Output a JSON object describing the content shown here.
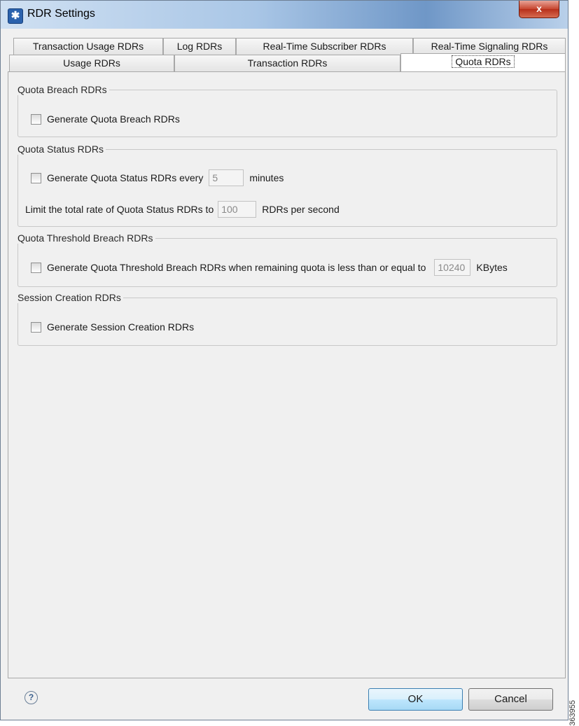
{
  "window": {
    "title": "RDR Settings",
    "close_label": "x"
  },
  "tabs_row1": [
    {
      "label": "Transaction Usage RDRs"
    },
    {
      "label": "Log RDRs"
    },
    {
      "label": "Real-Time Subscriber RDRs"
    },
    {
      "label": "Real-Time Signaling RDRs"
    }
  ],
  "tabs_row2": [
    {
      "label": "Usage RDRs"
    },
    {
      "label": "Transaction RDRs"
    },
    {
      "label": "Quota RDRs",
      "active": true
    }
  ],
  "groups": {
    "quota_breach": {
      "title": "Quota Breach RDRs",
      "generate_label": "Generate Quota Breach RDRs",
      "checked": false
    },
    "quota_status": {
      "title": "Quota Status RDRs",
      "generate_label": "Generate Quota Status RDRs every",
      "checked": false,
      "interval_value": "5",
      "interval_unit": "minutes",
      "limit_label": "Limit the total rate of Quota Status RDRs to",
      "limit_value": "100",
      "limit_unit": "RDRs per second"
    },
    "quota_threshold": {
      "title": "Quota Threshold Breach RDRs",
      "generate_label": "Generate Quota Threshold Breach RDRs when remaining quota is less than or equal to",
      "checked": false,
      "threshold_value": "10240",
      "threshold_unit": "KBytes"
    },
    "session_creation": {
      "title": "Session Creation RDRs",
      "generate_label": "Generate Session Creation RDRs",
      "checked": false
    }
  },
  "footer": {
    "help_icon": "?",
    "ok_label": "OK",
    "cancel_label": "Cancel"
  },
  "side_number": "363955",
  "colors": {
    "title_bar": "#a9c6e6",
    "close_button": "#c7452f",
    "ok_button": "#bee6fd"
  }
}
